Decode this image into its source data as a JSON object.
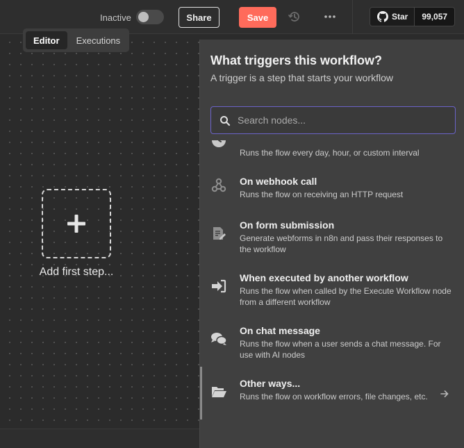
{
  "header": {
    "status_label": "Inactive",
    "share_label": "Share",
    "save_label": "Save",
    "github": {
      "star_label": "Star",
      "star_count": "99,057"
    }
  },
  "tabs": [
    {
      "label": "Editor",
      "active": true
    },
    {
      "label": "Executions",
      "active": false
    }
  ],
  "canvas": {
    "add_step_label": "Add first step..."
  },
  "panel": {
    "title": "What triggers this workflow?",
    "subtitle": "A trigger is a step that starts your workflow",
    "search": {
      "placeholder": "Search nodes...",
      "value": ""
    },
    "items": [
      {
        "icon": "clock-icon",
        "title": "",
        "description": "Runs the flow every day, hour, or custom interval"
      },
      {
        "icon": "webhook-icon",
        "title": "On webhook call",
        "description": "Runs the flow on receiving an HTTP request"
      },
      {
        "icon": "form-icon",
        "title": "On form submission",
        "description": "Generate webforms in n8n and pass their responses to the workflow"
      },
      {
        "icon": "sign-in-icon",
        "title": "When executed by another workflow",
        "description": "Runs the flow when called by the Execute Workflow node from a different workflow"
      },
      {
        "icon": "chat-icon",
        "title": "On chat message",
        "description": "Runs the flow when a user sends a chat message. For use with AI nodes"
      },
      {
        "icon": "folder-open-icon",
        "title": "Other ways...",
        "description": "Runs the flow on workflow errors, file changes, etc."
      }
    ]
  },
  "colors": {
    "save_button": "#ff6b5b",
    "search_border": "#6b63c9",
    "panel_background": "#404040",
    "canvas_background": "#2b2b2b"
  }
}
